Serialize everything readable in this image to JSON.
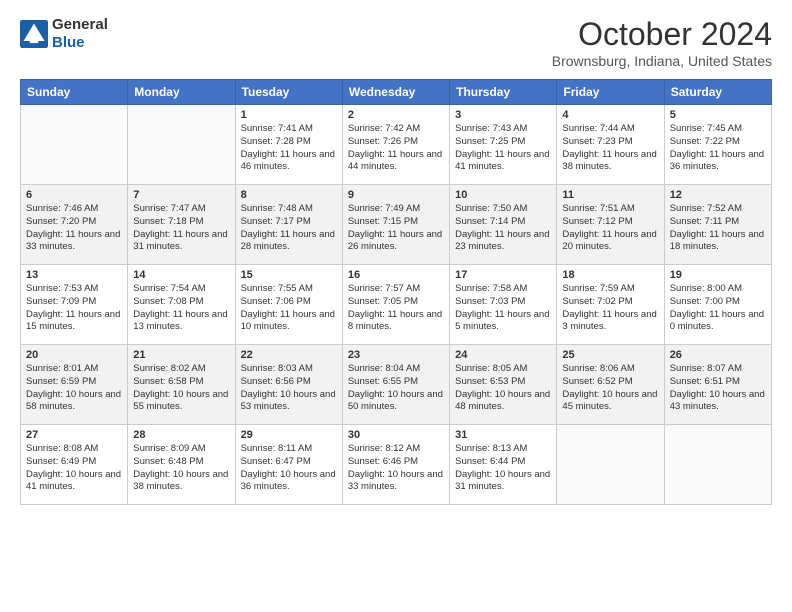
{
  "header": {
    "logo_line1": "General",
    "logo_line2": "Blue",
    "month": "October 2024",
    "location": "Brownsburg, Indiana, United States"
  },
  "days_of_week": [
    "Sunday",
    "Monday",
    "Tuesday",
    "Wednesday",
    "Thursday",
    "Friday",
    "Saturday"
  ],
  "weeks": [
    [
      {
        "num": "",
        "sunrise": "",
        "sunset": "",
        "daylight": ""
      },
      {
        "num": "",
        "sunrise": "",
        "sunset": "",
        "daylight": ""
      },
      {
        "num": "1",
        "sunrise": "Sunrise: 7:41 AM",
        "sunset": "Sunset: 7:28 PM",
        "daylight": "Daylight: 11 hours and 46 minutes."
      },
      {
        "num": "2",
        "sunrise": "Sunrise: 7:42 AM",
        "sunset": "Sunset: 7:26 PM",
        "daylight": "Daylight: 11 hours and 44 minutes."
      },
      {
        "num": "3",
        "sunrise": "Sunrise: 7:43 AM",
        "sunset": "Sunset: 7:25 PM",
        "daylight": "Daylight: 11 hours and 41 minutes."
      },
      {
        "num": "4",
        "sunrise": "Sunrise: 7:44 AM",
        "sunset": "Sunset: 7:23 PM",
        "daylight": "Daylight: 11 hours and 38 minutes."
      },
      {
        "num": "5",
        "sunrise": "Sunrise: 7:45 AM",
        "sunset": "Sunset: 7:22 PM",
        "daylight": "Daylight: 11 hours and 36 minutes."
      }
    ],
    [
      {
        "num": "6",
        "sunrise": "Sunrise: 7:46 AM",
        "sunset": "Sunset: 7:20 PM",
        "daylight": "Daylight: 11 hours and 33 minutes."
      },
      {
        "num": "7",
        "sunrise": "Sunrise: 7:47 AM",
        "sunset": "Sunset: 7:18 PM",
        "daylight": "Daylight: 11 hours and 31 minutes."
      },
      {
        "num": "8",
        "sunrise": "Sunrise: 7:48 AM",
        "sunset": "Sunset: 7:17 PM",
        "daylight": "Daylight: 11 hours and 28 minutes."
      },
      {
        "num": "9",
        "sunrise": "Sunrise: 7:49 AM",
        "sunset": "Sunset: 7:15 PM",
        "daylight": "Daylight: 11 hours and 26 minutes."
      },
      {
        "num": "10",
        "sunrise": "Sunrise: 7:50 AM",
        "sunset": "Sunset: 7:14 PM",
        "daylight": "Daylight: 11 hours and 23 minutes."
      },
      {
        "num": "11",
        "sunrise": "Sunrise: 7:51 AM",
        "sunset": "Sunset: 7:12 PM",
        "daylight": "Daylight: 11 hours and 20 minutes."
      },
      {
        "num": "12",
        "sunrise": "Sunrise: 7:52 AM",
        "sunset": "Sunset: 7:11 PM",
        "daylight": "Daylight: 11 hours and 18 minutes."
      }
    ],
    [
      {
        "num": "13",
        "sunrise": "Sunrise: 7:53 AM",
        "sunset": "Sunset: 7:09 PM",
        "daylight": "Daylight: 11 hours and 15 minutes."
      },
      {
        "num": "14",
        "sunrise": "Sunrise: 7:54 AM",
        "sunset": "Sunset: 7:08 PM",
        "daylight": "Daylight: 11 hours and 13 minutes."
      },
      {
        "num": "15",
        "sunrise": "Sunrise: 7:55 AM",
        "sunset": "Sunset: 7:06 PM",
        "daylight": "Daylight: 11 hours and 10 minutes."
      },
      {
        "num": "16",
        "sunrise": "Sunrise: 7:57 AM",
        "sunset": "Sunset: 7:05 PM",
        "daylight": "Daylight: 11 hours and 8 minutes."
      },
      {
        "num": "17",
        "sunrise": "Sunrise: 7:58 AM",
        "sunset": "Sunset: 7:03 PM",
        "daylight": "Daylight: 11 hours and 5 minutes."
      },
      {
        "num": "18",
        "sunrise": "Sunrise: 7:59 AM",
        "sunset": "Sunset: 7:02 PM",
        "daylight": "Daylight: 11 hours and 3 minutes."
      },
      {
        "num": "19",
        "sunrise": "Sunrise: 8:00 AM",
        "sunset": "Sunset: 7:00 PM",
        "daylight": "Daylight: 11 hours and 0 minutes."
      }
    ],
    [
      {
        "num": "20",
        "sunrise": "Sunrise: 8:01 AM",
        "sunset": "Sunset: 6:59 PM",
        "daylight": "Daylight: 10 hours and 58 minutes."
      },
      {
        "num": "21",
        "sunrise": "Sunrise: 8:02 AM",
        "sunset": "Sunset: 6:58 PM",
        "daylight": "Daylight: 10 hours and 55 minutes."
      },
      {
        "num": "22",
        "sunrise": "Sunrise: 8:03 AM",
        "sunset": "Sunset: 6:56 PM",
        "daylight": "Daylight: 10 hours and 53 minutes."
      },
      {
        "num": "23",
        "sunrise": "Sunrise: 8:04 AM",
        "sunset": "Sunset: 6:55 PM",
        "daylight": "Daylight: 10 hours and 50 minutes."
      },
      {
        "num": "24",
        "sunrise": "Sunrise: 8:05 AM",
        "sunset": "Sunset: 6:53 PM",
        "daylight": "Daylight: 10 hours and 48 minutes."
      },
      {
        "num": "25",
        "sunrise": "Sunrise: 8:06 AM",
        "sunset": "Sunset: 6:52 PM",
        "daylight": "Daylight: 10 hours and 45 minutes."
      },
      {
        "num": "26",
        "sunrise": "Sunrise: 8:07 AM",
        "sunset": "Sunset: 6:51 PM",
        "daylight": "Daylight: 10 hours and 43 minutes."
      }
    ],
    [
      {
        "num": "27",
        "sunrise": "Sunrise: 8:08 AM",
        "sunset": "Sunset: 6:49 PM",
        "daylight": "Daylight: 10 hours and 41 minutes."
      },
      {
        "num": "28",
        "sunrise": "Sunrise: 8:09 AM",
        "sunset": "Sunset: 6:48 PM",
        "daylight": "Daylight: 10 hours and 38 minutes."
      },
      {
        "num": "29",
        "sunrise": "Sunrise: 8:11 AM",
        "sunset": "Sunset: 6:47 PM",
        "daylight": "Daylight: 10 hours and 36 minutes."
      },
      {
        "num": "30",
        "sunrise": "Sunrise: 8:12 AM",
        "sunset": "Sunset: 6:46 PM",
        "daylight": "Daylight: 10 hours and 33 minutes."
      },
      {
        "num": "31",
        "sunrise": "Sunrise: 8:13 AM",
        "sunset": "Sunset: 6:44 PM",
        "daylight": "Daylight: 10 hours and 31 minutes."
      },
      {
        "num": "",
        "sunrise": "",
        "sunset": "",
        "daylight": ""
      },
      {
        "num": "",
        "sunrise": "",
        "sunset": "",
        "daylight": ""
      }
    ]
  ]
}
